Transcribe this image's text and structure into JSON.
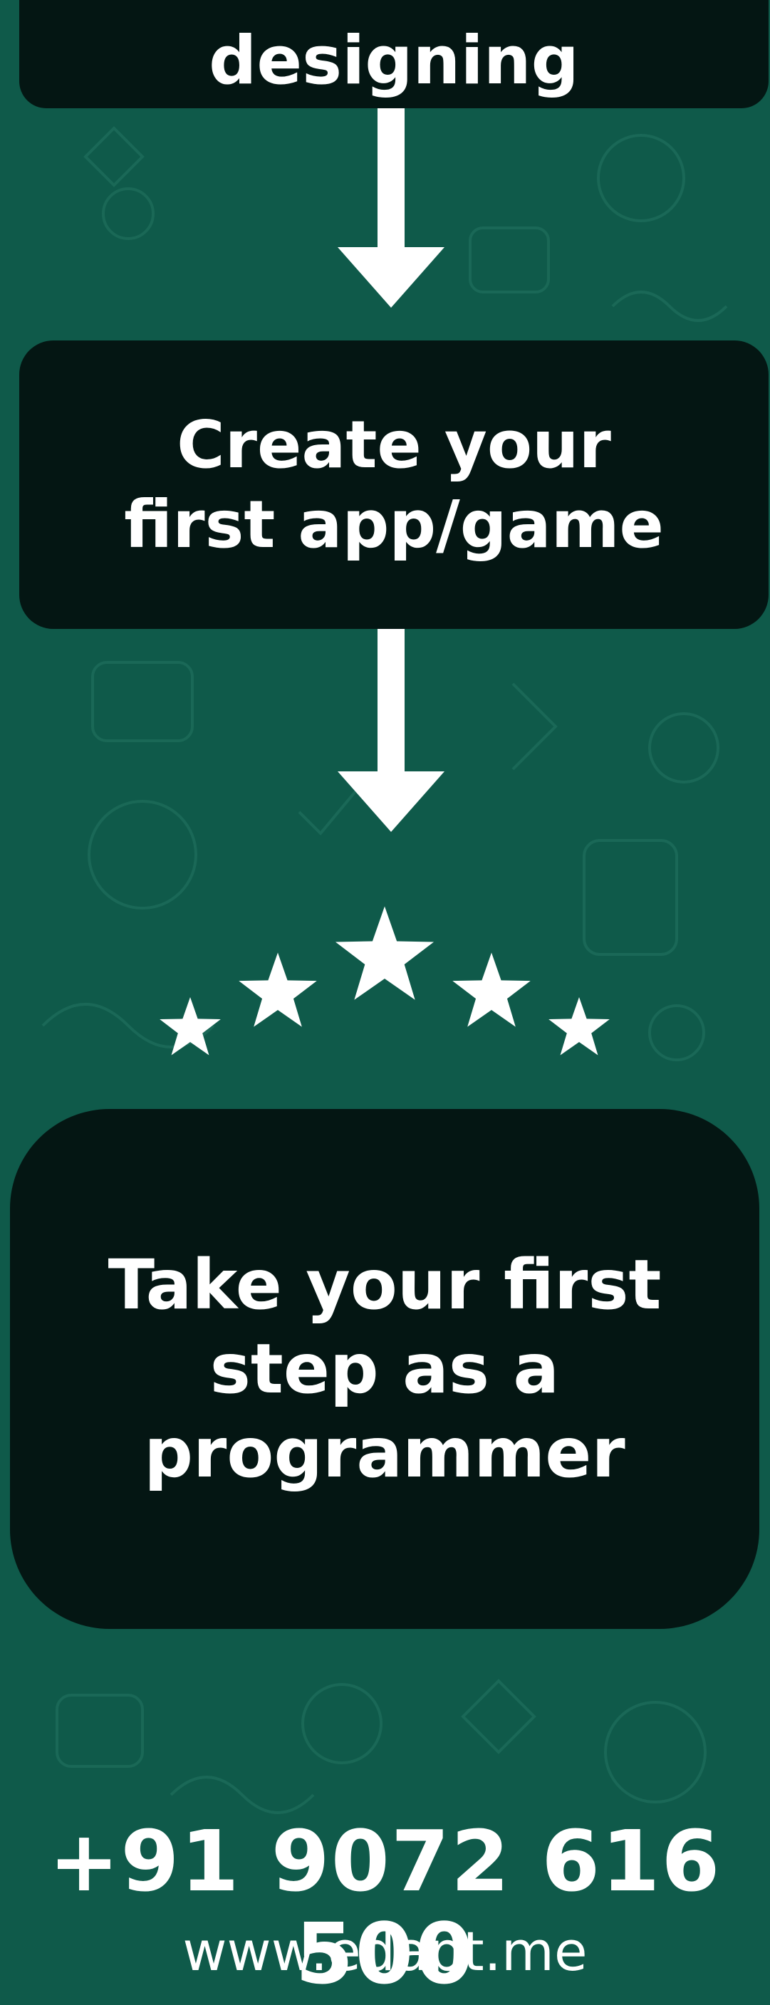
{
  "colors": {
    "background": "#0f5a4a",
    "card": "#041613",
    "text": "#ffffff",
    "pattern": "#1c6b59"
  },
  "steps": [
    {
      "text": "designing"
    },
    {
      "text": "Create your\nfirst app/game"
    },
    {
      "text": "Take your  first\nstep as a\nprogrammer"
    }
  ],
  "icons": {
    "arrow": "arrow-down-icon",
    "star": "star-icon",
    "pattern": "doodle-pattern"
  },
  "contact": {
    "phone": "+91 9072 616 500",
    "website": "www.edapt.me"
  }
}
